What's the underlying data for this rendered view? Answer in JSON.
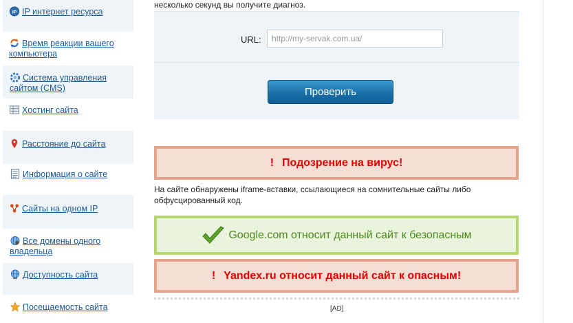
{
  "sidebar": {
    "items": [
      {
        "label": "IP интернет ресурса",
        "icon": "ip-icon"
      },
      {
        "label": "Время реакции вашего компьютера",
        "icon": "reaction-time-icon"
      },
      {
        "label": "Система управления сайтом (CMS)",
        "icon": "cms-icon"
      },
      {
        "label": "Хостинг сайта",
        "icon": "hosting-icon"
      },
      {
        "label": "Расстояние до сайта",
        "icon": "map-pin-icon"
      },
      {
        "label": "Информация о сайте",
        "icon": "document-icon"
      },
      {
        "label": "Сайты на одном IP",
        "icon": "network-icon"
      },
      {
        "label": "Все домены одного владельца",
        "icon": "globe-user-icon"
      },
      {
        "label": "Доступность сайта",
        "icon": "globe-icon"
      },
      {
        "label": "Посещаемость сайта",
        "icon": "star-icon"
      }
    ]
  },
  "main": {
    "intro": "несколько секунд вы получите диагноз.",
    "form": {
      "url_label": "URL:",
      "url_placeholder": "http://my-servak.com.ua/",
      "button_label": "Проверить"
    },
    "virus_alert": {
      "mark": "!",
      "text": "Подозрение на вирус!"
    },
    "description": "На сайте обнаружены iframe-вставки, ссылающиеся на сомнительные сайты либо обфусцированный код.",
    "google_status": "Google.com относит данный сайт к безопасным",
    "yandex_alert": {
      "mark": "!",
      "text": "Yandex.ru относит данный сайт к опасным!"
    },
    "ad_label": "[AD]"
  },
  "colors": {
    "link": "#1a5b9e",
    "alert_red_text": "#e00000",
    "alert_red_border": "#e3a38d",
    "alert_green_text": "#4b8a1e",
    "alert_green_border": "#b8d66e",
    "button": "#1a6fa8"
  }
}
